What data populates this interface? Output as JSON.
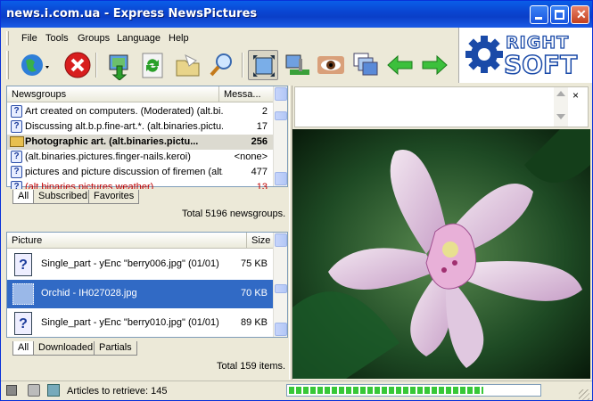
{
  "window": {
    "title": "news.i.com.ua - Express NewsPictures"
  },
  "menu": {
    "file": "File",
    "tools": "Tools",
    "groups": "Groups",
    "language": "Language",
    "help": "Help"
  },
  "logo": {
    "line1": "RIGHT",
    "line2": "SOFT"
  },
  "newsgroups": {
    "col_name": "Newsgroups",
    "col_messages": "Messa...",
    "rows": [
      {
        "name": "Art created on computers. (Moderated) (alt.bi...",
        "count": "2"
      },
      {
        "name": "Discussing alt.b.p.fine-art.*. (alt.binaries.pictu...",
        "count": "17"
      },
      {
        "name": "Photographic art. (alt.binaries.pictu...",
        "count": "256"
      },
      {
        "name": "(alt.binaries.pictures.finger-nails.keroi)",
        "count": "<none>"
      },
      {
        "name": "pictures and picture discussion of firemen (alt....",
        "count": "477"
      },
      {
        "name": "(alt.binaries.pictures.weather)",
        "count": "13"
      }
    ],
    "tabs": [
      "All",
      "Subscribed",
      "Favorites"
    ],
    "total": "Total 5196 newsgroups."
  },
  "pictures": {
    "col_name": "Picture",
    "col_size": "Size",
    "rows": [
      {
        "name": "Single_part - yEnc \"berry006.jpg\" (01/01)",
        "size": "75 KB"
      },
      {
        "name": "Orchid - IH027028.jpg",
        "size": "70 KB"
      },
      {
        "name": "Single_part - yEnc \"berry010.jpg\" (01/01)",
        "size": "89 KB"
      }
    ],
    "tabs": [
      "All",
      "Downloaded",
      "Partials"
    ],
    "total": "Total 159 items."
  },
  "status": {
    "text": "Articles to retrieve: 145",
    "progress": 0.78
  },
  "preview_close": "×"
}
